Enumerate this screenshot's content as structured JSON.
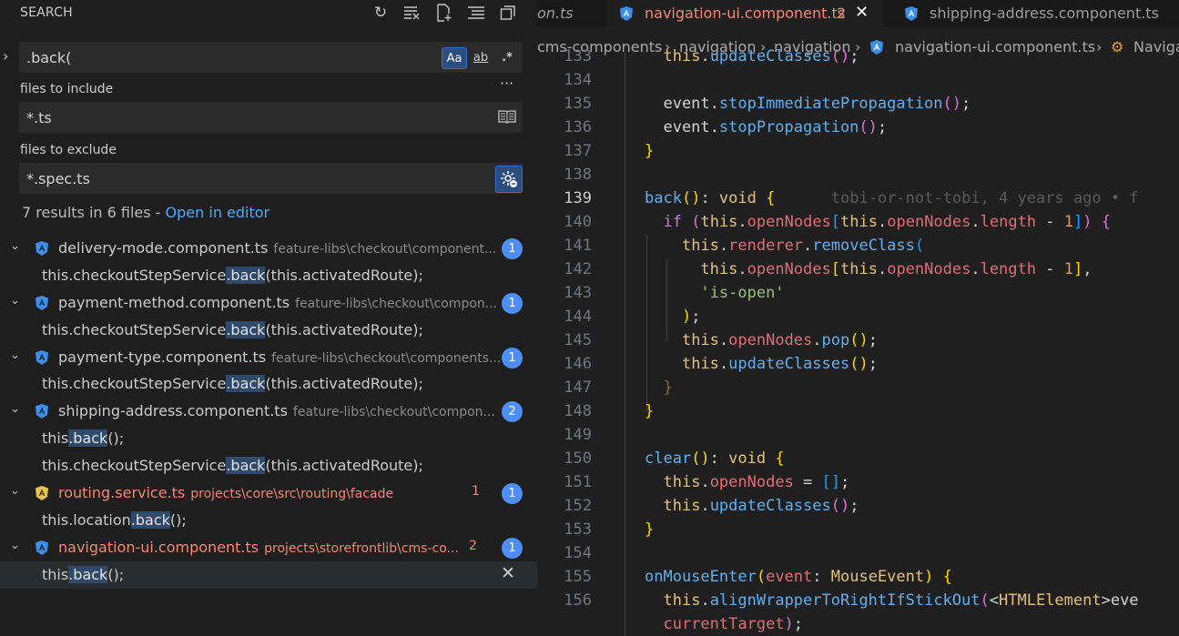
{
  "sidebar": {
    "title": "SEARCH",
    "search_value": ".back(",
    "opt_match_case": "Aa",
    "opt_whole_word": "ab",
    "opt_regex": ".*",
    "more": "···",
    "include_label": "files to include",
    "include_value": "*.ts",
    "exclude_label": "files to exclude",
    "exclude_value": "*.spec.ts",
    "summary_text": "7 results in 6 files - ",
    "summary_link": "Open in editor",
    "results": [
      {
        "file": "delivery-mode.component.ts",
        "path": "feature-libs\\checkout\\component...",
        "count": "1",
        "icon_color": "#3b8eea",
        "errors": "",
        "red": false,
        "matches": [
          {
            "pre": "this.checkoutStepService",
            "hl": ".back",
            "post": "(this.activatedRoute);"
          }
        ]
      },
      {
        "file": "payment-method.component.ts",
        "path": "feature-libs\\checkout\\compon...",
        "count": "1",
        "icon_color": "#3b8eea",
        "errors": "",
        "red": false,
        "matches": [
          {
            "pre": "this.checkoutStepService",
            "hl": ".back",
            "post": "(this.activatedRoute);"
          }
        ]
      },
      {
        "file": "payment-type.component.ts",
        "path": "feature-libs\\checkout\\components...",
        "count": "1",
        "icon_color": "#3b8eea",
        "errors": "",
        "red": false,
        "matches": [
          {
            "pre": "this.checkoutStepService",
            "hl": ".back",
            "post": "(this.activatedRoute);"
          }
        ]
      },
      {
        "file": "shipping-address.component.ts",
        "path": "feature-libs\\checkout\\compon...",
        "count": "2",
        "icon_color": "#3b8eea",
        "errors": "",
        "red": false,
        "matches": [
          {
            "pre": "this",
            "hl": ".back",
            "post": "();"
          },
          {
            "pre": "this.checkoutStepService",
            "hl": ".back",
            "post": "(this.activatedRoute);"
          }
        ]
      },
      {
        "file": "routing.service.ts",
        "path": "projects\\core\\src\\routing\\facade",
        "count": "1",
        "icon_color": "#e8c34a",
        "errors": "1",
        "red": true,
        "matches": [
          {
            "pre": "this.location",
            "hl": ".back",
            "post": "();"
          }
        ]
      },
      {
        "file": "navigation-ui.component.ts",
        "path": "projects\\storefrontlib\\cms-co...",
        "count": "1",
        "icon_color": "#3b8eea",
        "errors": "2",
        "red": true,
        "matches": [
          {
            "pre": "this",
            "hl": ".back",
            "post": "();"
          }
        ]
      }
    ]
  },
  "editor": {
    "tabs": [
      {
        "label": "on.ts"
      },
      {
        "label": "navigation-ui.component.ts",
        "badge": "2",
        "close": "✕"
      },
      {
        "label": "shipping-address.component.ts"
      }
    ],
    "breadcrumb": [
      "cms-components",
      "navigation",
      "navigation",
      "navigation-ui.component.ts",
      "Naviga"
    ],
    "blame": "tobi-or-not-tobi, 4 years ago • f",
    "line_numbers": [
      "133",
      "134",
      "135",
      "136",
      "137",
      "138",
      "139",
      "140",
      "141",
      "142",
      "143",
      "144",
      "145",
      "146",
      "147",
      "148",
      "149",
      "150",
      "151",
      "152",
      "153",
      "154",
      "155",
      "156",
      ""
    ]
  },
  "colors": {
    "accent": "#4e8ef7",
    "link": "#4daafc",
    "error": "#f48771",
    "highlight": "#2f4a6b"
  },
  "icons": [
    "refresh-icon",
    "clear-results-icon",
    "new-search-editor-icon",
    "collapse-all-icon",
    "view-as-tree-icon",
    "book-icon",
    "gear-exclude-icon",
    "angular-icon",
    "close-icon",
    "chevron-right-icon",
    "symbol-icon"
  ]
}
